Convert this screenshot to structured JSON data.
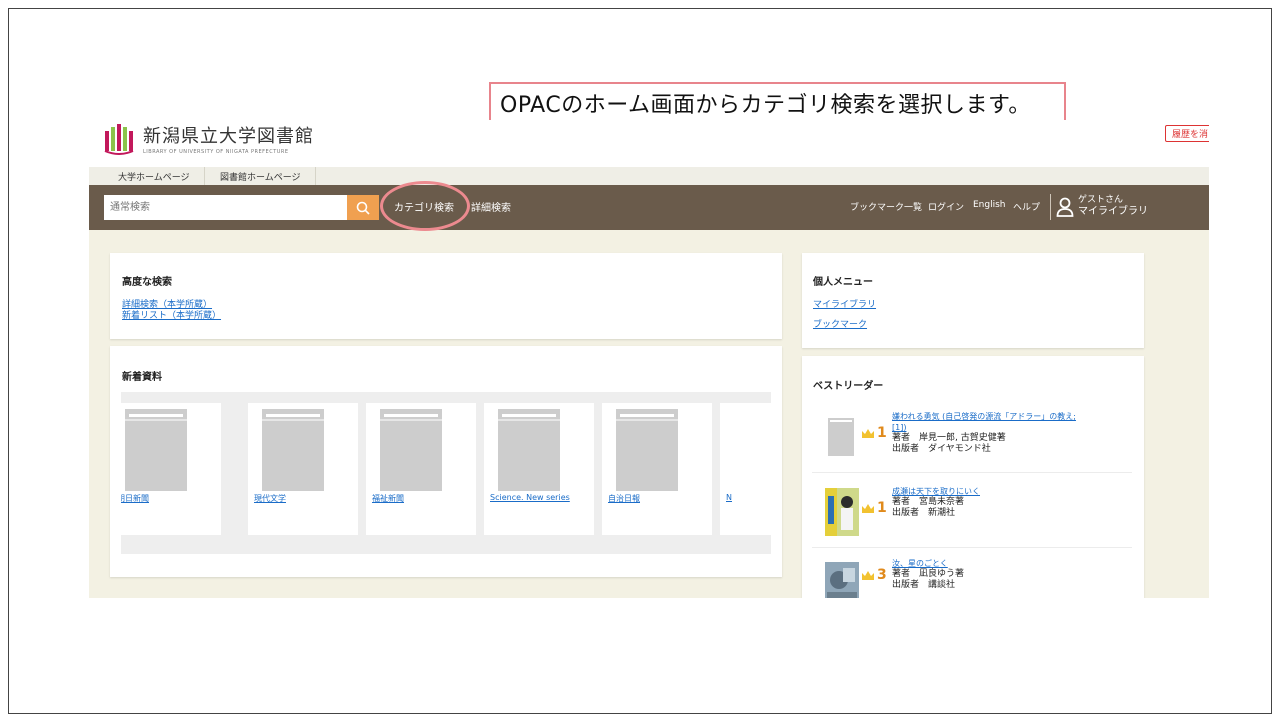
{
  "callout": {
    "text": "OPACのホーム画面からカテゴリ検索を選択します。"
  },
  "header": {
    "logo_title": "新潟県立大学図書館",
    "logo_sub": "LIBRARY OF UNIVERSITY OF NIIGATA PREFECTURE",
    "history_button": "履歴を消"
  },
  "toplinks": [
    "大学ホームページ",
    "図書館ホームページ"
  ],
  "navbar": {
    "search_placeholder": "通常検索",
    "category_search": "カテゴリ検索",
    "advanced_search": "詳細検索",
    "bookmarks": "ブックマーク一覧",
    "login": "ログイン",
    "english": "English",
    "help": "ヘルプ",
    "user_name": "ゲストさん",
    "my_library": "マイライブラリ"
  },
  "advanced_panel": {
    "title": "高度な検索",
    "links": [
      "詳細検索（本学所蔵）",
      "新着リスト（本学所蔵）"
    ]
  },
  "new_items": {
    "title": "新着資料",
    "books": [
      "朝日新聞",
      "現代文学",
      "福祉新聞",
      "Science. New series",
      "自治日報",
      "N"
    ]
  },
  "personal_menu": {
    "title": "個人メニュー",
    "links": [
      "マイライブラリ",
      "ブックマーク"
    ]
  },
  "best_reader": {
    "title": "ベストリーダー",
    "items": [
      {
        "rank": "1",
        "title": "嫌われる勇気 (自己啓発の源流「アドラー」の教え;",
        "title2": "[1])",
        "author": "著者　岸見一郎, 古賀史健著",
        "publisher": "出版者　ダイヤモンド社"
      },
      {
        "rank": "1",
        "title": "成瀬は天下を取りにいく",
        "author": "著者　宮島未奈著",
        "publisher": "出版者　新潮社"
      },
      {
        "rank": "3",
        "title": "汝、星のごとく",
        "author": "著者　凪良ゆう著",
        "publisher": "出版者　講談社"
      }
    ]
  },
  "colors": {
    "navbar": "#6a5b4b",
    "search_button": "#f0a050",
    "highlight": "#ec8a8f",
    "link": "#1a6cc8"
  }
}
